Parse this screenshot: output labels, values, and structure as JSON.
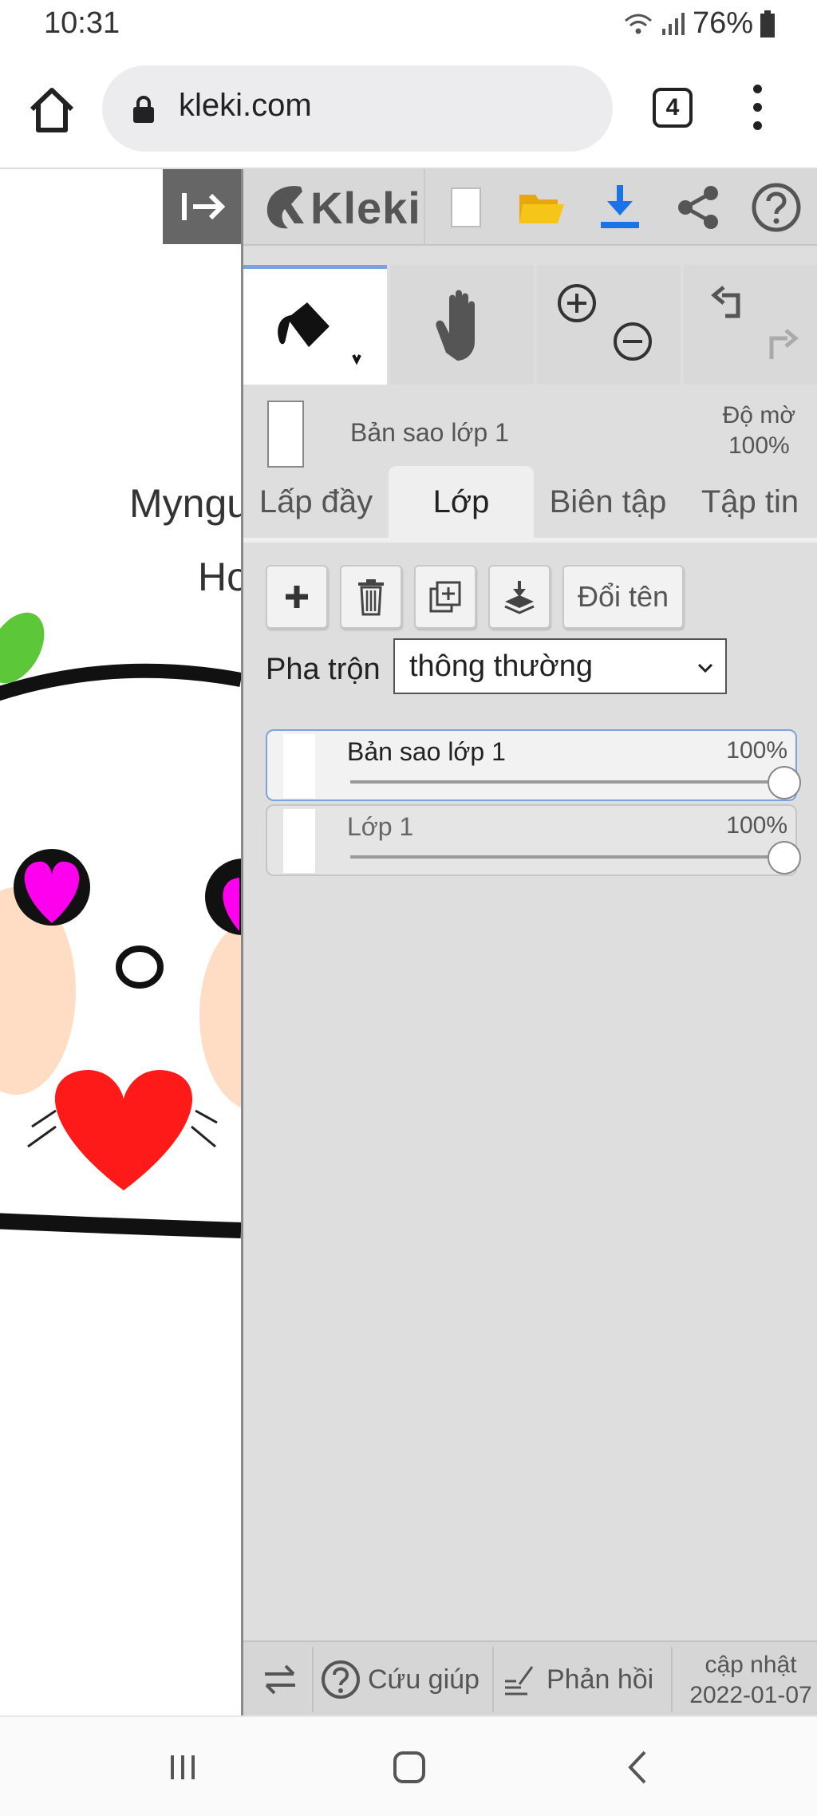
{
  "status_bar": {
    "time": "10:31",
    "battery": "76%"
  },
  "browser": {
    "url": "kleki.com",
    "tab_count": "4"
  },
  "canvas": {
    "caption_line1": "Myngu",
    "caption_line2": "Ho"
  },
  "toolbar": {
    "logo": "Kleki"
  },
  "layer_info": {
    "current_layer": "Bản sao lớp 1",
    "opacity_label": "Độ mờ",
    "opacity_value": "100%"
  },
  "tabs": [
    {
      "label": "Lấp đầy"
    },
    {
      "label": "Lớp"
    },
    {
      "label": "Biên tập"
    },
    {
      "label": "Tập tin"
    }
  ],
  "layer_panel": {
    "rename_label": "Đổi tên",
    "blend_label": "Pha trộn",
    "blend_value": "thông thường",
    "layers": [
      {
        "name": "Bản sao lớp 1",
        "opacity": "100%",
        "level": 1.0,
        "selected": true
      },
      {
        "name": "Lớp 1",
        "opacity": "100%",
        "level": 1.0,
        "selected": false
      }
    ]
  },
  "footer": {
    "help_label": "Cứu giúp",
    "feedback_label": "Phản hồi",
    "update_label": "cập nhật",
    "update_date": "2022-01-07"
  },
  "colors": {
    "accent": "#7aa3e0",
    "download_blue": "#1a73e8",
    "folder_yellow": "#f5c518"
  }
}
